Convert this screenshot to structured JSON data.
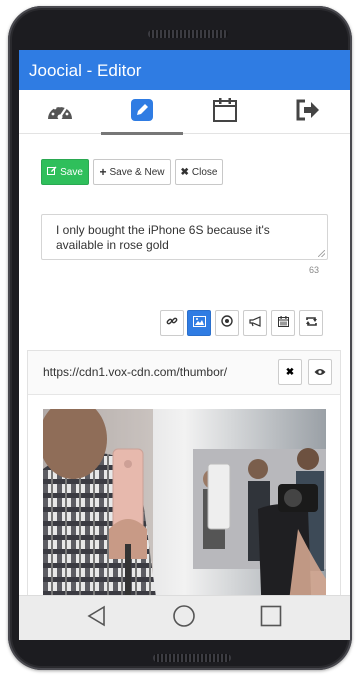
{
  "app": {
    "title": "Joocial - Editor"
  },
  "tabs": [
    {
      "name": "dashboard",
      "icon": "dashboard-icon",
      "active": false
    },
    {
      "name": "editor",
      "icon": "pencil-icon",
      "active": true
    },
    {
      "name": "calendar",
      "icon": "calendar-icon",
      "active": false
    },
    {
      "name": "logout",
      "icon": "sign-out-icon",
      "active": false
    }
  ],
  "toolbar": {
    "save_label": "Save",
    "save_new_label": "Save & New",
    "close_label": "Close"
  },
  "post": {
    "text": "I only bought the iPhone 6S because it's available in rose gold",
    "char_count": "63"
  },
  "tools": [
    {
      "name": "link",
      "icon": "link-icon",
      "active": false
    },
    {
      "name": "image",
      "icon": "image-icon",
      "active": true
    },
    {
      "name": "target",
      "icon": "dot-circle-icon",
      "active": false
    },
    {
      "name": "announce",
      "icon": "bullhorn-icon",
      "active": false
    },
    {
      "name": "schedule",
      "icon": "calendar-icon",
      "active": false
    },
    {
      "name": "repeat",
      "icon": "retweet-icon",
      "active": false
    }
  ],
  "image_card": {
    "url": "https://cdn1.vox-cdn.com/thumbor/"
  },
  "colors": {
    "primary": "#2f7ce3",
    "save_green": "#2fbf5b"
  },
  "system_nav": [
    "back-icon",
    "home-icon",
    "recents-icon"
  ]
}
